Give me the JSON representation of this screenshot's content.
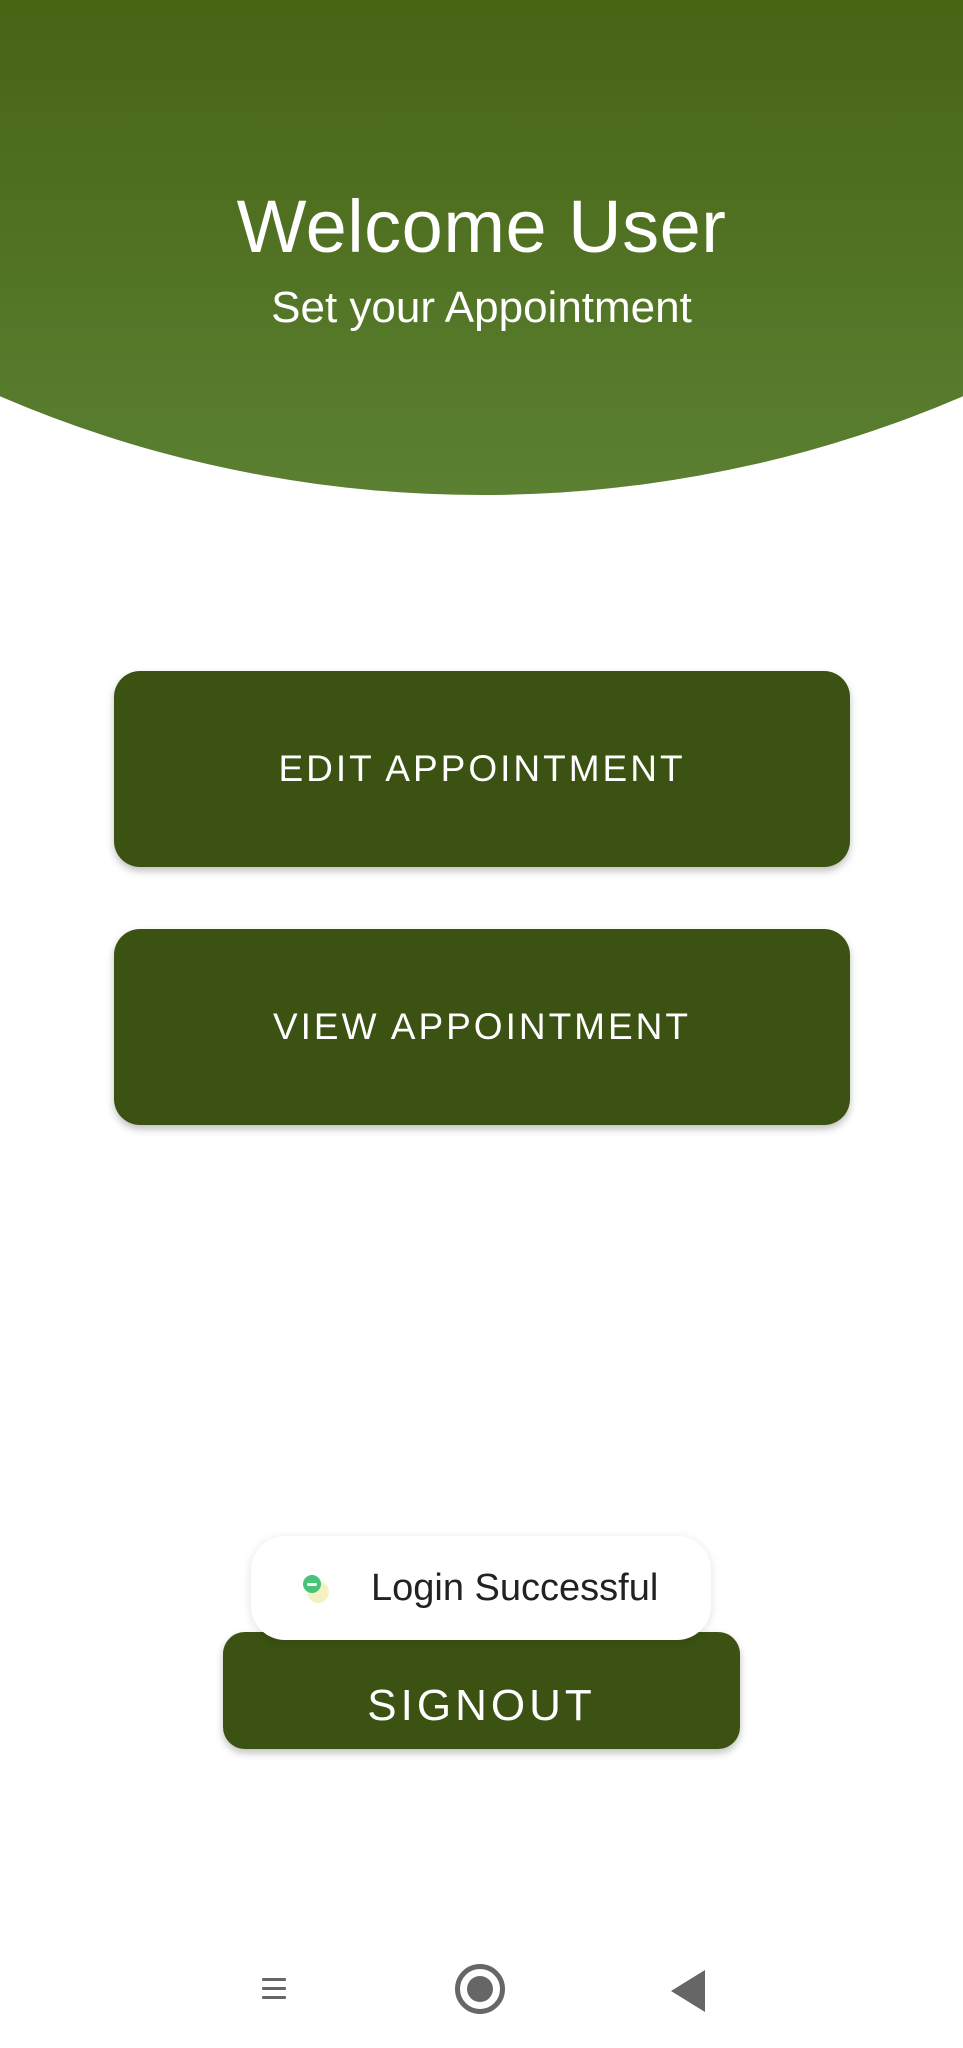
{
  "header": {
    "title": "Welcome User",
    "subtitle": "Set your Appointment"
  },
  "actions": {
    "edit_label": "EDIT APPOINTMENT",
    "view_label": "VIEW APPOINTMENT",
    "signout_label": "SIGNOUT"
  },
  "toast": {
    "message": "Login Successful",
    "icon": "app-icon"
  },
  "navbar": {
    "icons": [
      "menu-icon",
      "home-icon",
      "back-icon"
    ]
  },
  "colors": {
    "header_top": "#44600f",
    "header_bottom": "#5b8032",
    "button": "#3b5212",
    "background": "#ffffff"
  }
}
